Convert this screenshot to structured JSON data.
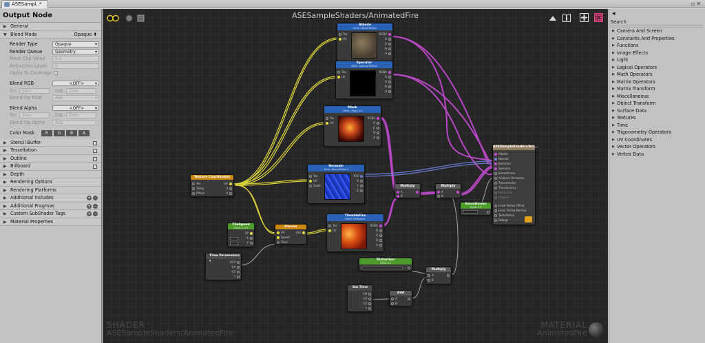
{
  "tab": {
    "label": "ASESampl..*"
  },
  "left_panel": {
    "title": "Output Node",
    "general_label": "General",
    "blend_mode": {
      "label": "Blend Mode",
      "value": "Opaque"
    },
    "render_type": {
      "label": "Render Type",
      "value": "Opaque"
    },
    "render_queue": {
      "label": "Render Queue",
      "value": "Geometry"
    },
    "mask_clip": {
      "label": "Mask Clip Value",
      "value": "0.5"
    },
    "refraction": {
      "label": "Refraction Layer",
      "value": "0"
    },
    "alpha_coverage": {
      "label": "Alpha To Coverage"
    },
    "blend_rgb": {
      "label": "Blend RGB",
      "value": "<OFF>"
    },
    "src_dst_1": {
      "src": "Src",
      "src_val": "Zero",
      "dst": "Dst",
      "dst_val": "Zero"
    },
    "blend_op_rgb": {
      "label": "Blend Op RGB",
      "value": "Add"
    },
    "blend_alpha": {
      "label": "Blend Alpha",
      "value": "<OFF>"
    },
    "src_dst_2": {
      "src": "Src",
      "src_val": "Zero",
      "dst": "Dst",
      "dst_val": "Zero"
    },
    "blend_op_alpha": {
      "label": "Blend Op Alpha",
      "value": "Add"
    },
    "color_mask": {
      "label": "Color Mask",
      "channels": [
        "R",
        "G",
        "B",
        "A"
      ]
    },
    "sections": [
      "Stencil Buffer",
      "Tessellation",
      "Outline",
      "Billboard",
      "Depth",
      "Rendering Options",
      "Rendering Platforms",
      "Additional Includes",
      "Additional Pragmas",
      "Custom SubShader Tags",
      "Material Properties"
    ]
  },
  "canvas": {
    "title": "ASESampleShaders/AnimatedFire",
    "watermark_left": {
      "kind": "SHADER",
      "name": "ASESampleShaders/AnimatedFire"
    },
    "watermark_right": {
      "kind": "MATERIAL",
      "name": "AnimatedFire"
    },
    "nodes": {
      "albedo": {
        "title": "Albedo",
        "sub": "Value: AlbedoTexture",
        "in1": "Tex",
        "in2": "UV",
        "outs": [
          "RGBA",
          "R",
          "G",
          "B",
          "A"
        ]
      },
      "specular": {
        "title": "Specular",
        "sub": "Value: SpecularTexture",
        "in1": "Tex",
        "in2": "UV",
        "outs": [
          "RGBA",
          "R",
          "G",
          "B",
          "A"
        ]
      },
      "mask": {
        "title": "Mask",
        "sub": "Value: _Mask_0.0",
        "in1": "Tex",
        "in2": "UV",
        "outs": [
          "RGBA",
          "R",
          "G",
          "B",
          "A"
        ]
      },
      "normals": {
        "title": "Normals",
        "sub": "Value: NormalTexture",
        "in1": "Tex",
        "in2": "UV",
        "in3": "Scale",
        "outs": [
          "XYZ",
          "X",
          "Y",
          "Z"
        ]
      },
      "tileable": {
        "title": "TileableFire",
        "sub": "Value: FireTexture",
        "in1": "Tex",
        "in2": "UV",
        "outs": [
          "RGBA",
          "R",
          "G",
          "B",
          "A"
        ]
      },
      "texcoords": {
        "title": "Texture Coordinates",
        "ins": [
          "Tex",
          "Tiling",
          "Offset"
        ],
        "outs": [
          "UV",
          "U",
          "V"
        ]
      },
      "tilespeed": {
        "title": "TileSpeed",
        "sub": "Value: 1, 0.5",
        "outs": [
          "XY",
          "X",
          "Y"
        ]
      },
      "panner": {
        "title": "Panner",
        "ins": [
          "UV",
          "Speed",
          "Time"
        ],
        "out": "Out"
      },
      "time_params": {
        "title": "Time Parameters",
        "outs": [
          "t/20",
          "t/4",
          "t/2",
          "t"
        ]
      },
      "multiply1": {
        "title": "Multiply",
        "ins": [
          "A",
          "B"
        ]
      },
      "multiply2": {
        "title": "Multiply",
        "ins": [
          "A",
          "B"
        ]
      },
      "smoothness": {
        "title": "Smoothness",
        "sub": "Value: 0.5"
      },
      "distortion": {
        "title": "Distortion",
        "sub": "Value: 0.5"
      },
      "multiply3": {
        "title": "Multiply",
        "ins": [
          "A",
          "B"
        ]
      },
      "sin_time": {
        "title": "Sin Time",
        "outs": [
          "t/8",
          "t/4",
          "t/2",
          "t"
        ]
      },
      "add": {
        "title": "Add",
        "ins": [
          "A",
          "B"
        ]
      },
      "output": {
        "title": "ASESampleShaders/Ani...",
        "ports": [
          "Albedo",
          "Normal",
          "Emission",
          "Specular",
          "Smoothness",
          "Ambient Occlusion",
          "Transmission",
          "Translucency",
          "Refraction",
          "Opacity",
          "Local Vertex Offset",
          "Local Vertex Normal",
          "Tessellation",
          "Debug"
        ]
      }
    },
    "wire_colors": {
      "uv": "#e6df3c",
      "color": "#c84bd6",
      "normal": "#6d7fd8",
      "float": "#bcbcbc"
    }
  },
  "right_panel": {
    "search_label": "Search",
    "items": [
      "Camera And Screen",
      "Constants And Properties",
      "Functions",
      "Image Effects",
      "Light",
      "Logical Operators",
      "Math Operators",
      "Matrix Operators",
      "Matrix Transform",
      "Miscellaneous",
      "Object Transform",
      "Surface Data",
      "Textures",
      "Time",
      "Trigonometry Operators",
      "UV Coordinates",
      "Vector Operators",
      "Vertex Data"
    ]
  }
}
